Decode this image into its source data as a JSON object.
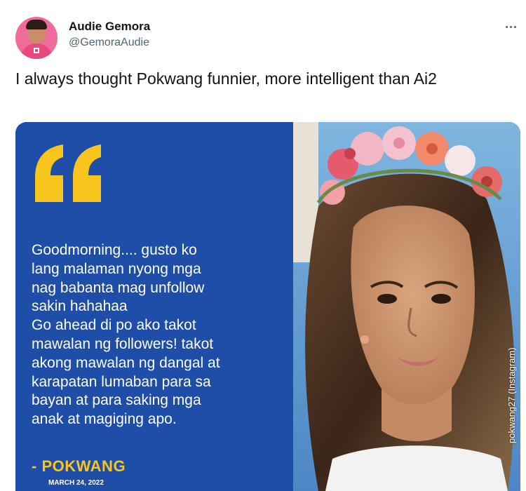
{
  "tweet": {
    "author": {
      "display_name": "Audie Gemora",
      "handle": "@GemoraAudie"
    },
    "more_icon": "more-horizontal-icon",
    "text": "I always thought Pokwang funnier, more intelligent than Ai2"
  },
  "media": {
    "quote_text": "Goodmorning.... gusto ko\nlang malaman nyong mga\nnag babanta mag unfollow\nsakin hahahaa\nGo ahead di po ako takot\nmawalan ng followers! takot\nakong mawalan ng dangal at\nkarapatan lumaban para sa\nbayan at para saking mga\nanak at magiging apo.",
    "quote_author": "- POKWANG",
    "quote_date": "MARCH 24, 2022",
    "photo_credit": "pokwang27 (Instagram)",
    "colors": {
      "panel_blue": "#1e4ea7",
      "quote_yellow": "#f7c51e"
    }
  }
}
